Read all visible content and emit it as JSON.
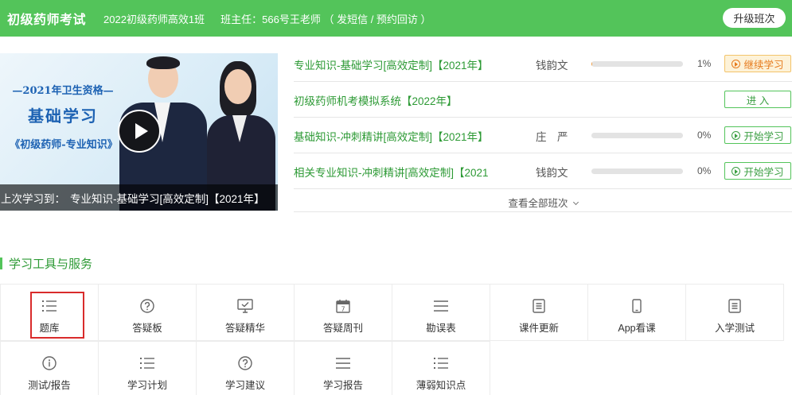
{
  "header": {
    "title": "初级药师考试",
    "class_name": "2022初级药师高效1班",
    "teacher": "班主任：566号王老师 （ 发短信 / 预约回访 ）",
    "upgrade_label": "升级班次"
  },
  "banner": {
    "year_text": "—2021年卫生资格—",
    "main_text": "基础学习",
    "sub_text": "《初级药师-专业知识》",
    "last_label": "上次学习到：",
    "last_course": "专业知识-基础学习[高效定制]【2021年】"
  },
  "courses": [
    {
      "name": "专业知识-基础学习[高效定制]【2021年】",
      "teacher": "钱韵文",
      "progress": 1,
      "progress_text": "1%",
      "button": "继续学习",
      "button_type": "continue"
    },
    {
      "name": "初级药师机考模拟系统【2022年】",
      "teacher": "",
      "progress": null,
      "progress_text": "",
      "button": "进 入",
      "button_type": "enter"
    },
    {
      "name": "基础知识-冲刺精讲[高效定制]【2021年】",
      "teacher": "庄　严",
      "progress": 0,
      "progress_text": "0%",
      "button": "开始学习",
      "button_type": "start"
    },
    {
      "name": "相关专业知识-冲刺精讲[高效定制]【2021",
      "teacher": "钱韵文",
      "progress": 0,
      "progress_text": "0%",
      "button": "开始学习",
      "button_type": "start"
    }
  ],
  "view_all_label": "查看全部班次",
  "tools_section": {
    "title": "学习工具与服务",
    "rows": [
      [
        {
          "label": "题库",
          "icon": "list-icon",
          "highlighted": true
        },
        {
          "label": "答疑板",
          "icon": "question-circle-icon",
          "highlighted": false
        },
        {
          "label": "答疑精华",
          "icon": "monitor-icon",
          "highlighted": false
        },
        {
          "label": "答疑周刊",
          "icon": "calendar-icon",
          "highlighted": false
        },
        {
          "label": "勘误表",
          "icon": "menu-lines-icon",
          "highlighted": false
        },
        {
          "label": "课件更新",
          "icon": "document-icon",
          "highlighted": false
        },
        {
          "label": "App看课",
          "icon": "phone-icon",
          "highlighted": false
        },
        {
          "label": "入学测试",
          "icon": "document-icon",
          "highlighted": false
        }
      ],
      [
        {
          "label": "测试/报告",
          "icon": "info-circle-icon",
          "highlighted": false
        },
        {
          "label": "学习计划",
          "icon": "list-icon",
          "highlighted": false
        },
        {
          "label": "学习建议",
          "icon": "question-circle-icon",
          "highlighted": false
        },
        {
          "label": "学习报告",
          "icon": "menu-lines-icon",
          "highlighted": false
        },
        {
          "label": "薄弱知识点",
          "icon": "list-icon",
          "highlighted": false
        }
      ]
    ]
  },
  "colors": {
    "brand_green": "#53c45a",
    "link_green": "#2d9a35",
    "continue_orange": "#e67a1c",
    "highlight_red": "#d92b2b"
  }
}
